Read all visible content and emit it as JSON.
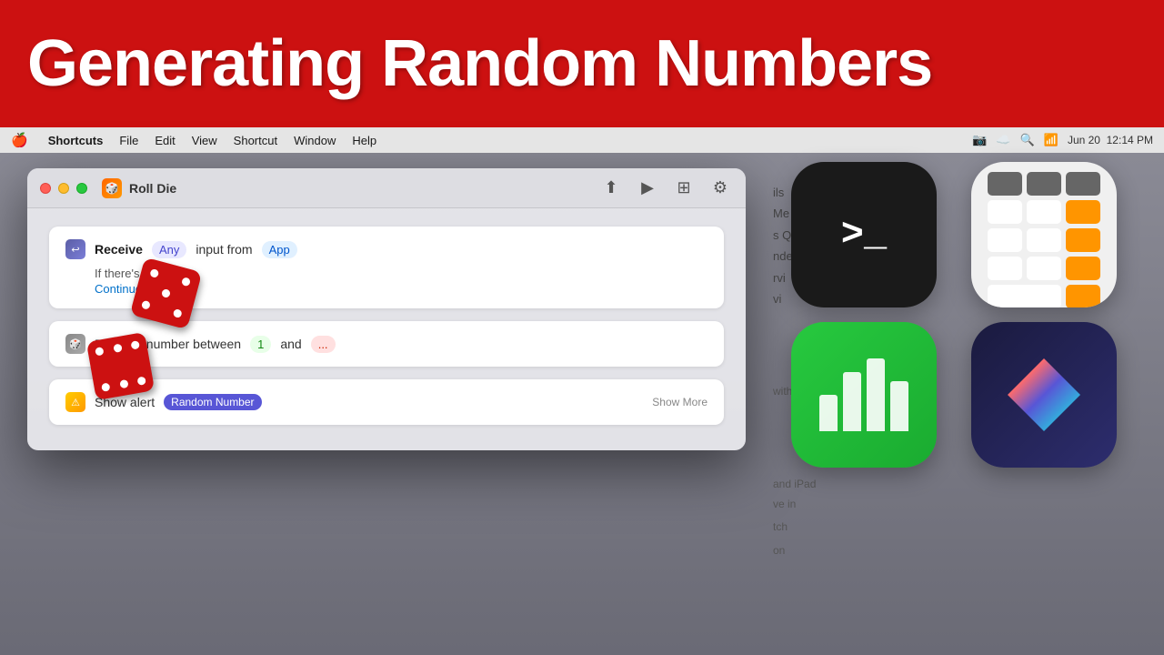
{
  "title_banner": {
    "text": "Generating Random Numbers"
  },
  "menubar": {
    "apple": "🍎",
    "items": [
      "Shortcuts",
      "File",
      "Edit",
      "View",
      "Shortcut",
      "Window",
      "Help"
    ],
    "shortcuts_bold": true,
    "right": {
      "time": "12:14 PM",
      "date": "Jun 20"
    }
  },
  "window": {
    "title": "Roll Die",
    "icon_label": "🎲",
    "blocks": [
      {
        "type": "receive",
        "icon": "↩",
        "label_receive": "Receive",
        "label_any": "Any",
        "label_input_from": "input from",
        "if_no_input": "If there's no input:",
        "continue": "Continue"
      },
      {
        "type": "random",
        "label": "Random number between",
        "number": "1",
        "label_and": "and"
      },
      {
        "type": "alert",
        "label_show": "Show alert",
        "badge": "Random Number",
        "show_more": "Show More"
      }
    ]
  },
  "app_icons": [
    {
      "name": "Terminal",
      "type": "terminal",
      "prompt": ">_"
    },
    {
      "name": "Calculator",
      "type": "calculator"
    },
    {
      "name": "Numbers",
      "type": "numbers"
    },
    {
      "name": "Shortcuts",
      "type": "shortcuts"
    }
  ],
  "details_text": [
    "ils",
    "Me",
    "s Q",
    "nde",
    "rvi",
    "vi"
  ],
  "dice": {
    "label": "dice"
  }
}
